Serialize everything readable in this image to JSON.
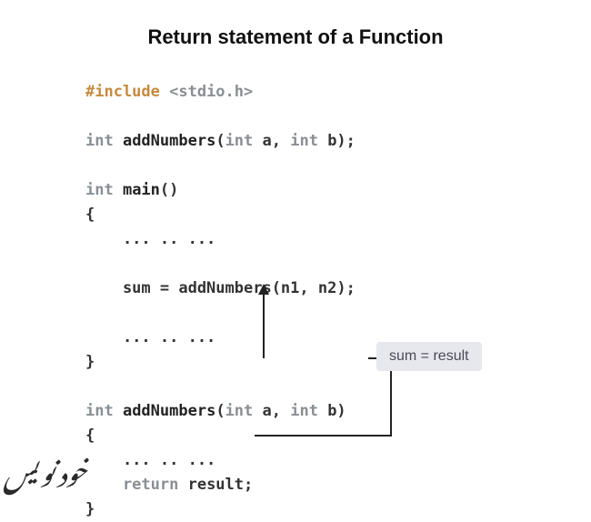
{
  "title": "Return statement of a Function",
  "code": {
    "l1_include": "#include",
    "l1_lib": " <stdio.h>",
    "blank": "",
    "l3_int": "int",
    "l3_fn": " addNumbers",
    "l3_sig_open": "(",
    "l3_int2": "int",
    "l3_a": " a, ",
    "l3_int3": "int",
    "l3_b": " b);",
    "l5_int": "int",
    "l5_main": " main",
    "l5_paren": "()",
    "l6_brace": "{",
    "l7_dots": "    ... .. ...",
    "l9_call": "    sum = addNumbers(n1, n2);",
    "l11_dots": "    ... .. ...",
    "l12_brace": "}",
    "l14_int": "int",
    "l14_fn": " addNumbers",
    "l14_sig_open": "(",
    "l14_int2": "int",
    "l14_a": " a, ",
    "l14_int3": "int",
    "l14_b": " b)",
    "l15_brace": "{",
    "l16_dots": "    ... .. ...",
    "l17_return": "    return",
    "l17_result": " result;",
    "l18_brace": "}"
  },
  "badge": "sum = result",
  "watermark": "خود نویس"
}
